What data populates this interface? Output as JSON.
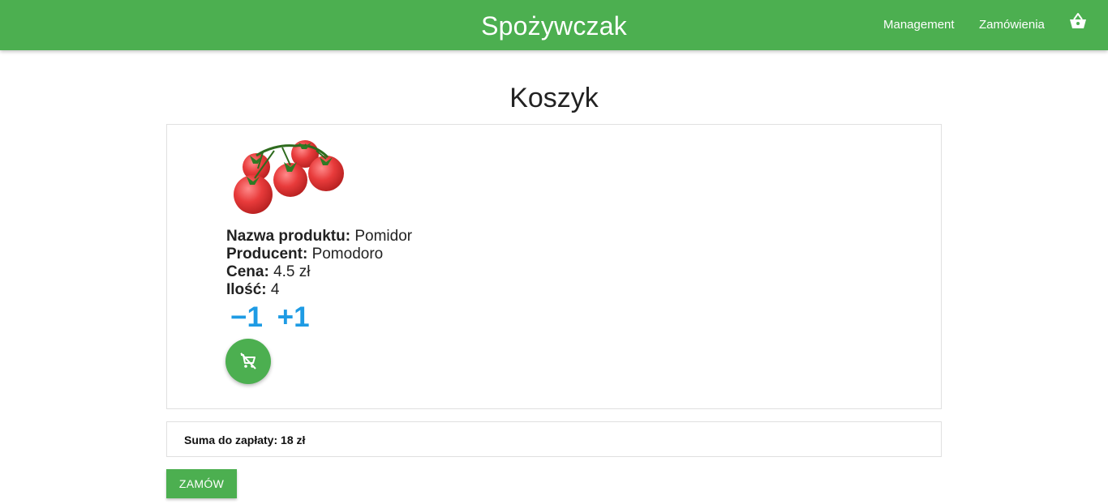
{
  "navbar": {
    "brand": "Spożywczak",
    "links": {
      "management": "Management",
      "orders": "Zamówienia"
    },
    "cart_icon": "basket-icon",
    "background": "#4caf50"
  },
  "page": {
    "title": "Koszyk"
  },
  "cart_items": [
    {
      "image_icon": "tomato-image",
      "name_label": "Nazwa produktu:",
      "name_value": "Pomidor",
      "producer_label": "Producent:",
      "producer_value": "Pomodoro",
      "price_label": "Cena:",
      "price_value": "4.5 zł",
      "quantity_label": "Ilość:",
      "quantity_value": "4",
      "decrement_label": "−1",
      "increment_label": "+1",
      "remove_icon": "remove-from-cart-icon"
    }
  ],
  "summary": {
    "label": "Suma do zapłaty:",
    "value": "18 zł"
  },
  "actions": {
    "order_label": "ZAMÓW"
  },
  "colors": {
    "accent": "#4caf50",
    "link_blue": "#1e9be4"
  }
}
